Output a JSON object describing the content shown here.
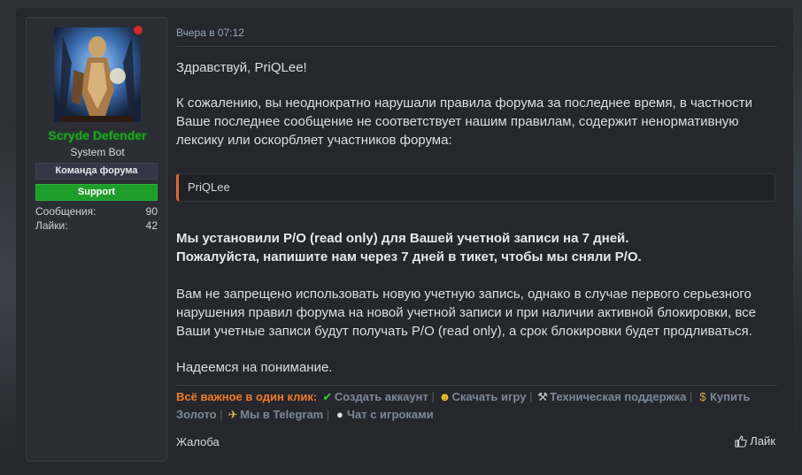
{
  "author": {
    "name": "Scryde Defender",
    "title": "System Bot",
    "banner_team": "Команда форума",
    "banner_support": "Support",
    "stats": [
      {
        "label": "Сообщения:",
        "value": "90"
      },
      {
        "label": "Лайки:",
        "value": "42"
      }
    ],
    "name_color": "#1fa51f",
    "status_color": "#d02a2a"
  },
  "post": {
    "timestamp": "Вчера в 07:12",
    "greeting": "Здравствуй, PriQLee!",
    "paragraph1": "К сожалению, вы неоднократно нарушали правила форума за последнее время, в частности Ваше последнее сообщение не соответствует нашим правилам, содержит ненормативную лексику или оскорбляет участников форума:",
    "quote": "PriQLee",
    "bold_line1": "Мы установили Р/О (read only) для Вашей учетной записи на 7 дней.",
    "bold_line2": "Пожалуйста, напишите нам через 7 дней в тикет, чтобы мы сняли Р/О.",
    "paragraph2": "Вам не запрещено использовать новую учетную запись, однако в случае первого серьезного нарушения правил форума на новой учетной записи и при наличии активной блокировки, все Ваши учетные записи будут получать Р/О (read only), а срок блокировки будет продливаться.",
    "closing": "Надеемся на понимание."
  },
  "signature": {
    "lead": "Всё важное в один клик:",
    "links": [
      {
        "icon": "check-icon",
        "label": "Создать аккаунт"
      },
      {
        "icon": "sunglasses-smile-icon",
        "label": "Скачать игру"
      },
      {
        "icon": "wrench-icon",
        "label": "Техническая поддержка"
      },
      {
        "icon": "money-bag-icon",
        "label": "Купить Золото"
      },
      {
        "icon": "telegram-icon",
        "label": "Мы в Telegram"
      },
      {
        "icon": "speech-bubble-icon",
        "label": "Чат с игроками"
      }
    ],
    "separator": "|"
  },
  "actions": {
    "report": "Жалоба",
    "like": "Лайк"
  }
}
